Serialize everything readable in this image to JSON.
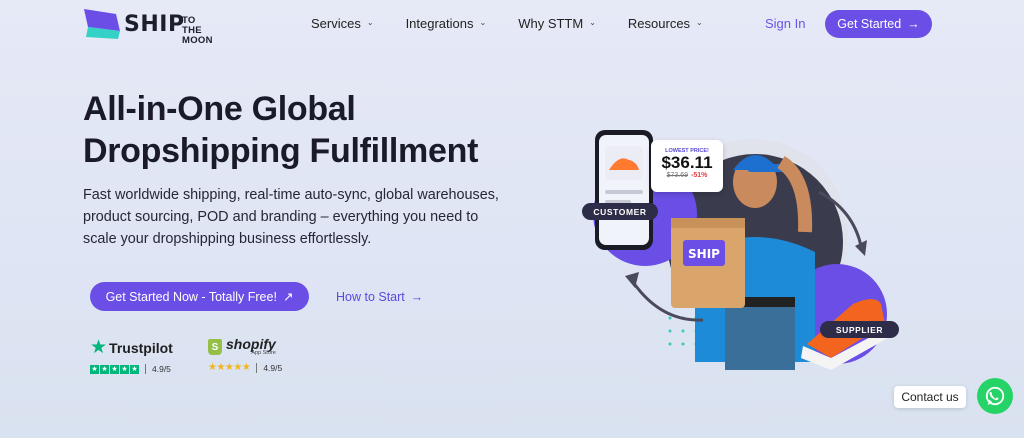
{
  "brand": {
    "name": "SHIP",
    "name_small_1": "TO THE",
    "name_small_2": "MOON"
  },
  "nav": {
    "items": [
      {
        "label": "Services"
      },
      {
        "label": "Integrations"
      },
      {
        "label": "Why STTM"
      },
      {
        "label": "Resources"
      }
    ],
    "signin_label": "Sign In",
    "cta_label": "Get Started"
  },
  "hero": {
    "title_line1": "All-in-One Global",
    "title_line2": "Dropshipping Fulfillment",
    "subtitle": "Fast worldwide shipping, real-time auto-sync, global warehouses, product sourcing, POD and branding – everything you need to scale your dropshipping business effortlessly.",
    "primary_cta": "Get Started Now - Totally Free!",
    "secondary_cta": "How to Start"
  },
  "ratings": {
    "trustpilot": {
      "name": "Trustpilot",
      "score": "4.9/5"
    },
    "shopify": {
      "name": "shopify",
      "sub": "App Store",
      "score": "4.9/5"
    }
  },
  "illustration": {
    "price_label": "LOWEST PRICE!",
    "price": "$36.11",
    "old_price": "$73.69",
    "discount": "-51%",
    "box_text": "SHIP",
    "tag_customer": "CUSTOMER",
    "tag_supplier": "SUPPLIER"
  },
  "contact": {
    "label": "Contact us"
  },
  "colors": {
    "accent": "#6a4ee6",
    "trustpilot": "#00b67a",
    "shopify": "#95bf47",
    "whatsapp": "#25d366"
  }
}
